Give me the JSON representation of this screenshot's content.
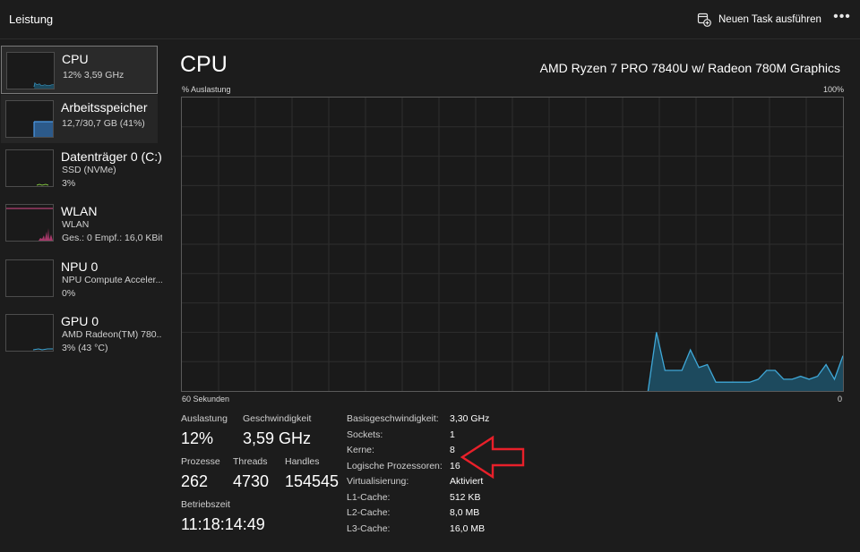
{
  "titlebar": {
    "title": "Leistung",
    "run_task_label": "Neuen Task ausführen",
    "more_label": "•••"
  },
  "sidebar": {
    "items": [
      {
        "name": "CPU",
        "sub1": "12%  3,59 GHz",
        "sub2": ""
      },
      {
        "name": "Arbeitsspeicher",
        "sub1": "12,7/30,7 GB (41%)",
        "sub2": ""
      },
      {
        "name": "Datenträger 0 (C:)",
        "sub1": "SSD (NVMe)",
        "sub2": "3%"
      },
      {
        "name": "WLAN",
        "sub1": "WLAN",
        "sub2": "Ges.: 0  Empf.: 16,0 KBit"
      },
      {
        "name": "NPU 0",
        "sub1": "NPU Compute Acceler...",
        "sub2": "0%"
      },
      {
        "name": "GPU 0",
        "sub1": "AMD Radeon(TM) 780...",
        "sub2": "3% (43 °C)"
      }
    ]
  },
  "main": {
    "title": "CPU",
    "model": "AMD Ryzen 7 PRO 7840U w/ Radeon 780M Graphics",
    "graph_label_left": "% Auslastung",
    "graph_label_right": "100%",
    "graph_bottom_left": "60 Sekunden",
    "graph_bottom_right": "0"
  },
  "stats": {
    "auslastung_label": "Auslastung",
    "auslastung_value": "12%",
    "geschwindigkeit_label": "Geschwindigkeit",
    "geschwindigkeit_value": "3,59 GHz",
    "prozesse_label": "Prozesse",
    "prozesse_value": "262",
    "threads_label": "Threads",
    "threads_value": "4730",
    "handles_label": "Handles",
    "handles_value": "154545",
    "betriebszeit_label": "Betriebszeit",
    "betriebszeit_value": "11:18:14:49"
  },
  "details": [
    {
      "key": "Basisgeschwindigkeit:",
      "value": "3,30 GHz"
    },
    {
      "key": "Sockets:",
      "value": "1"
    },
    {
      "key": "Kerne:",
      "value": "8"
    },
    {
      "key": "Logische Prozessoren:",
      "value": "16"
    },
    {
      "key": "Virtualisierung:",
      "value": "Aktiviert"
    },
    {
      "key": "L1-Cache:",
      "value": "512 KB"
    },
    {
      "key": "L2-Cache:",
      "value": "8,0 MB"
    },
    {
      "key": "L3-Cache:",
      "value": "16,0 MB"
    }
  ],
  "cpu_graph": {
    "ymax": 100,
    "values": [
      0,
      0,
      0,
      0,
      0,
      0,
      0,
      0,
      0,
      0,
      0,
      0,
      0,
      0,
      0,
      0,
      0,
      0,
      0,
      0,
      0,
      0,
      0,
      0,
      0,
      0,
      0,
      0,
      0,
      0,
      0,
      0,
      0,
      0,
      0,
      0,
      0,
      0,
      0,
      0,
      0,
      0,
      0,
      0,
      0,
      0,
      0,
      0,
      0,
      0,
      0,
      0,
      0,
      0,
      0,
      0,
      20,
      7,
      7,
      7,
      14,
      8,
      9,
      3,
      3,
      3,
      3,
      3,
      4,
      7,
      7,
      4,
      4,
      5,
      4,
      5,
      9,
      4,
      12
    ]
  },
  "colors": {
    "accent": "#4cc2ff",
    "graph_fill": "#1d4a5e",
    "graph_line": "#3fa8d8",
    "memory_fill": "#2c5a8a",
    "wlan_color": "#d94a8a",
    "annotation_arrow": "#e8202a"
  }
}
